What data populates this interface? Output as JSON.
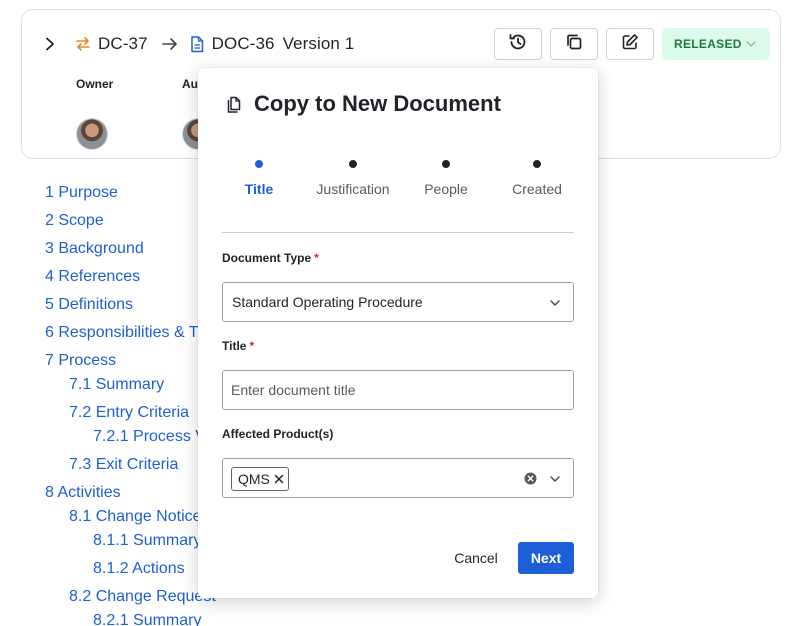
{
  "header": {
    "change_id": "DC-37",
    "doc_id": "DOC-36",
    "version": "Version 1",
    "status": "RELEASED",
    "people": {
      "owner_label": "Owner",
      "author_label": "Au"
    },
    "icons": {
      "expand": "chevron-right-icon",
      "change": "swap-arrows-icon",
      "doc": "document-icon",
      "history": "history-icon",
      "copy": "copy-icon",
      "edit": "edit-icon"
    },
    "colors": {
      "change_icon": "#e8871e",
      "doc_icon": "#1d5fd6",
      "status_bg": "#dcfaea",
      "status_text": "#1e7a46"
    }
  },
  "toc": [
    "1 Purpose",
    "2 Scope",
    "3 Background",
    "4 References",
    "5 Definitions",
    "6 Responsibilities & T",
    "7 Process",
    "7.1 Summary",
    "7.2 Entry Criteria",
    "7.2.1 Process V",
    "7.3 Exit Criteria",
    "8 Activities",
    "8.1 Change Notice",
    "8.1.1 Summary",
    "8.1.2 Actions",
    "8.2 Change Request",
    "8.2.1 Summary"
  ],
  "modal": {
    "title": "Copy to New Document",
    "steps": [
      "Title",
      "Justification",
      "People",
      "Created"
    ],
    "active_step": "Title",
    "document_type": {
      "label": "Document Type",
      "required_mark": "*",
      "value": "Standard Operating Procedure"
    },
    "title_field": {
      "label": "Title",
      "required_mark": "*",
      "value": "",
      "placeholder": "Enter document title"
    },
    "affected_products": {
      "label": "Affected Product(s)",
      "tags": [
        "QMS"
      ]
    },
    "cancel_label": "Cancel",
    "next_label": "Next",
    "colors": {
      "primary": "#1d5fd6",
      "required": "#d42a2a"
    }
  }
}
